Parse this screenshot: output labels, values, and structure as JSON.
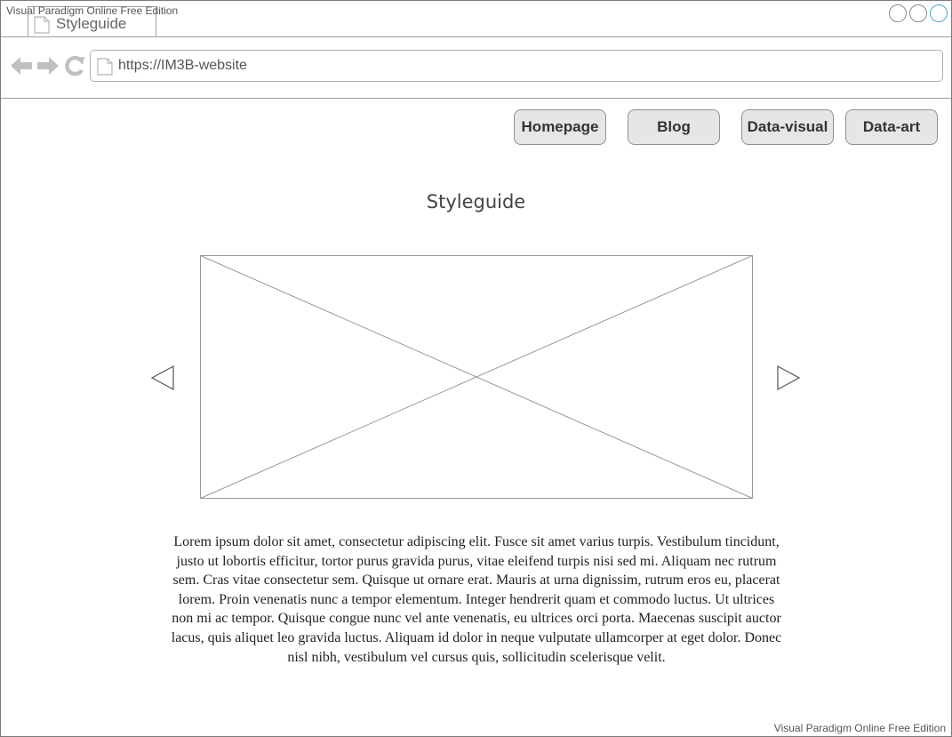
{
  "watermark": "Visual Paradigm Online Free Edition",
  "browser": {
    "tab_title": "Styleguide",
    "url": "https://IM3B-website",
    "icons": {
      "back": "back-arrow-icon",
      "forward": "forward-arrow-icon",
      "reload": "reload-icon",
      "page": "page-icon"
    },
    "window_controls": [
      "minimize",
      "maximize",
      "close"
    ]
  },
  "nav": {
    "homepage": "Homepage",
    "blog": "Blog",
    "data_visual": "Data-visual",
    "data_art": "Data-art"
  },
  "main": {
    "title": "Styleguide",
    "carousel": {
      "prev_icon": "triangle-left-icon",
      "next_icon": "triangle-right-icon",
      "image": "image-placeholder"
    },
    "body_text": "Lorem ipsum dolor sit amet, consectetur adipiscing elit. Fusce sit amet varius turpis. Vestibulum tincidunt, justo ut lobortis efficitur, tortor purus gravida purus, vitae eleifend turpis nisi sed mi. Aliquam nec rutrum sem. Cras vitae consectetur sem. Quisque ut ornare erat. Mauris at urna dignissim, rutrum eros eu, placerat lorem. Proin venenatis nunc a tempor elementum. Integer hendrerit quam et commodo luctus. Ut ultrices non mi ac tempor. Quisque congue nunc vel ante venenatis, eu ultrices orci porta. Maecenas suscipit auctor lacus, quis aliquet leo gravida luctus. Aliquam id dolor in neque vulputate ullamcorper at eget dolor. Donec nisl nibh, vestibulum vel cursus quis, sollicitudin scelerisque velit."
  },
  "colors": {
    "border": "#7a7a7a",
    "button_fill": "#e6e6e6",
    "icon_gray": "#c0c0c0",
    "close_accent": "#4aa8d8"
  }
}
